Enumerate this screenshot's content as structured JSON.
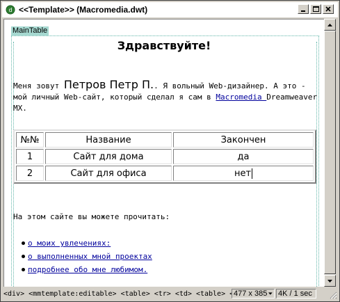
{
  "window": {
    "title": "<<Template>> (Macromedia.dwt)",
    "buttons": {
      "minimize": "_",
      "maximize": "□",
      "close": "×"
    }
  },
  "document": {
    "region_label": "MainTable",
    "heading": "Здравствуйте!",
    "intro": {
      "prefix": "Меня зовут ",
      "name": "Петров Петр П.",
      "middle": ". Я вольный Web-дизайнер. А это - мой личный Web-сайт, который сделал я сам в ",
      "link": "Macromedia ",
      "suffix": "Dreamweaver MX."
    },
    "table": {
      "headers": [
        "№№",
        "Название",
        "Закончен"
      ],
      "rows": [
        [
          "1",
          "Сайт для дома",
          "да"
        ],
        [
          "2",
          "Сайт для офиса",
          "нет"
        ]
      ]
    },
    "read_text": "На этом сайте вы можете прочитать:",
    "topics": [
      "о моих увлечениях:",
      "о выполненных мной проектах",
      "подробнее обо мне любимом."
    ]
  },
  "statusbar": {
    "tag_path": "<div> <mmtemplate:editable> <table> <tr> <td> <table> <tr> <td> <div>",
    "window_size": "477 x 385",
    "download": "4K / 1 sec"
  },
  "icons": {
    "app": "dreamweaver-doc-icon",
    "minimize": "minimize-icon",
    "maximize": "maximize-icon",
    "close": "close-icon",
    "scroll_up": "arrow-up-icon",
    "scroll_down": "arrow-down-icon"
  }
}
